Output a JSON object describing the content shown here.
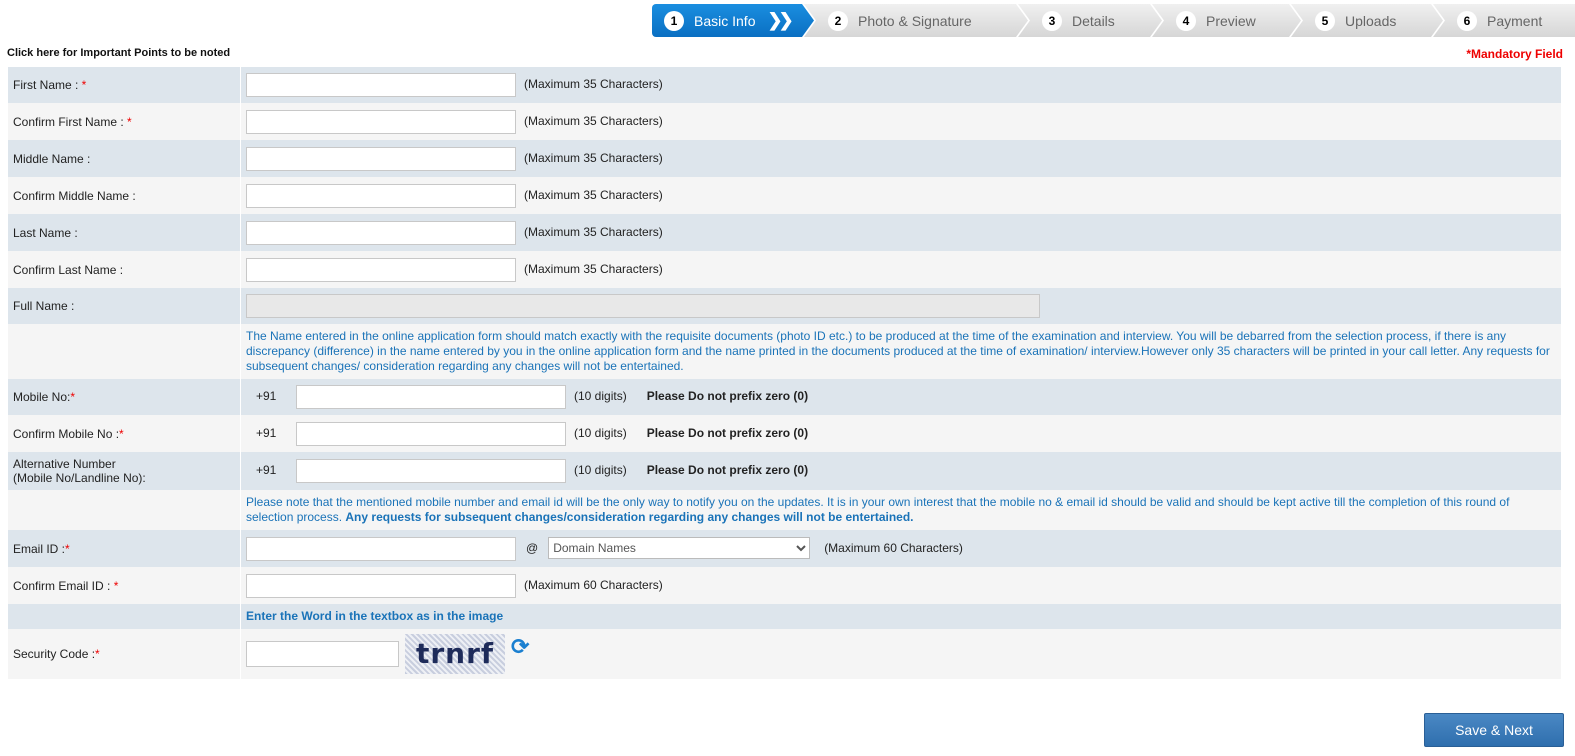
{
  "steps": [
    {
      "num": "1",
      "label": "Basic Info"
    },
    {
      "num": "2",
      "label": "Photo & Signature"
    },
    {
      "num": "3",
      "label": "Details"
    },
    {
      "num": "4",
      "label": "Preview"
    },
    {
      "num": "5",
      "label": "Uploads"
    },
    {
      "num": "6",
      "label": "Payment"
    }
  ],
  "important_link": "Click here for Important Points to be noted",
  "mandatory": "*Mandatory Field",
  "fields": {
    "first_name": "First Name : ",
    "confirm_first_name": "Confirm First Name : ",
    "middle_name": "Middle Name :",
    "confirm_middle_name": "Confirm Middle Name :",
    "last_name": "Last Name :",
    "confirm_last_name": "Confirm Last Name :",
    "full_name": "Full Name :",
    "mobile": "Mobile No:",
    "confirm_mobile": "Confirm Mobile No :",
    "alt_number_1": "Alternative Number",
    "alt_number_2": "(Mobile No/Landline No):",
    "email": "Email ID :",
    "confirm_email": "Confirm Email ID : ",
    "security": "Security Code :"
  },
  "star": "*",
  "max35": "(Maximum 35 Characters)",
  "max60": "(Maximum 60 Characters)",
  "prefix": "+91",
  "digits": "(10 digits)",
  "no_zero": "Please Do not prefix zero (0)",
  "name_note": "The Name entered in the online application form should match exactly with the requisite documents (photo ID etc.) to be produced at the time of the examination and interview. You will be debarred from the selection process, if there is any discrepancy (difference) in the name entered by you in the online application form and the name printed in the documents produced at the time of examination/ interview.However only 35 characters will be printed in your call letter. Any requests for subsequent changes/ consideration regarding any changes will not be entertained.",
  "mobile_note": "Please note that the mentioned mobile number and email id will be the only way to notify you on the updates. It is in your own interest that the mobile no & email id should be valid and should be kept active till the completion of this round of selection process.",
  "mobile_note_bold": "Any requests for subsequent changes/consideration regarding any changes will not be entertained.",
  "at": "@",
  "domain_select": "Domain Names",
  "captcha_heading": "Enter the Word in the textbox as in the image",
  "captcha_text": "trnrf",
  "save_next": "Save & Next"
}
